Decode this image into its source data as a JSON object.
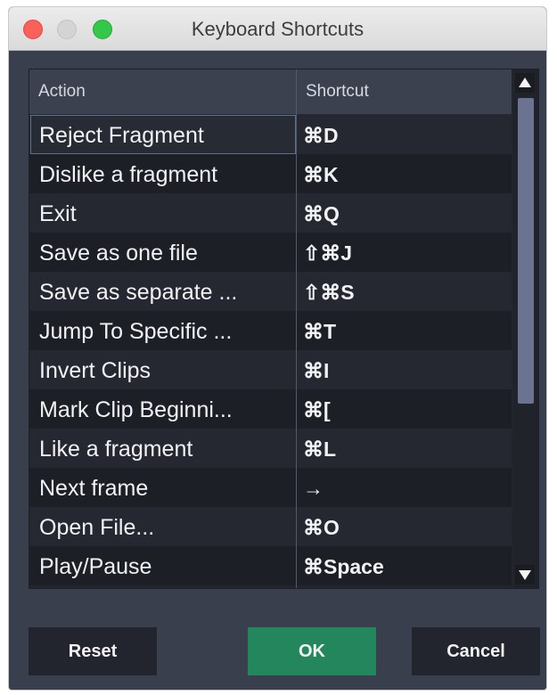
{
  "window": {
    "title": "Keyboard Shortcuts"
  },
  "table": {
    "columns": {
      "action": "Action",
      "shortcut": "Shortcut"
    },
    "rows": [
      {
        "action": "Reject Fragment",
        "shortcut": "⌘D"
      },
      {
        "action": "Dislike a fragment",
        "shortcut": "⌘K"
      },
      {
        "action": "Exit",
        "shortcut": "⌘Q"
      },
      {
        "action": "Save as one file",
        "shortcut": "⇧⌘J"
      },
      {
        "action": "Save as separate ...",
        "shortcut": "⇧⌘S"
      },
      {
        "action": "Jump To Specific ...",
        "shortcut": "⌘T"
      },
      {
        "action": "Invert Clips",
        "shortcut": "⌘I"
      },
      {
        "action": "Mark Clip Beginni...",
        "shortcut": "⌘["
      },
      {
        "action": "Like a fragment",
        "shortcut": "⌘L"
      },
      {
        "action": "Next frame",
        "shortcut": "→"
      },
      {
        "action": "Open File...",
        "shortcut": "⌘O"
      },
      {
        "action": "Play/Pause",
        "shortcut": "⌘Space"
      }
    ],
    "selected_row": 0,
    "scroll_position": 0
  },
  "buttons": {
    "reset": "Reset",
    "ok": "OK",
    "cancel": "Cancel"
  },
  "colors": {
    "primary_button": "#23865c",
    "window_bg": "#3a3f4d",
    "selection_border": "#5b708f"
  }
}
